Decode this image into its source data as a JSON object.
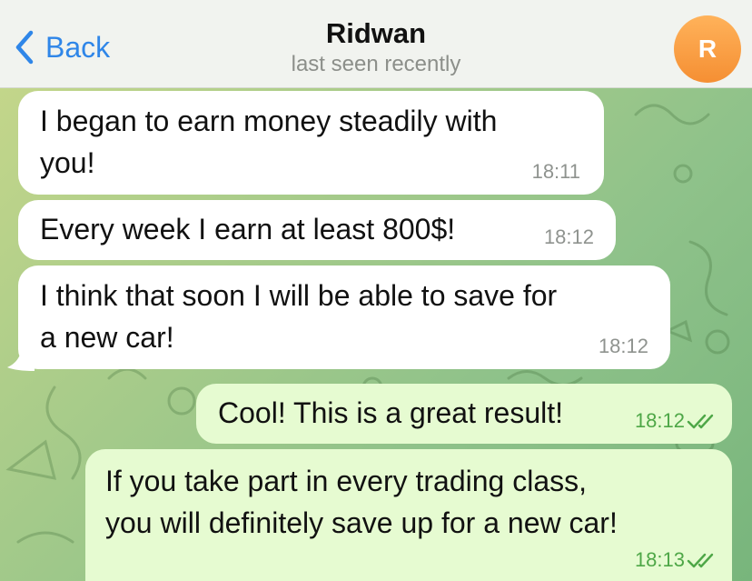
{
  "header": {
    "back_label": "Back",
    "contact_name": "Ridwan",
    "status": "last seen recently",
    "avatar_initial": "R"
  },
  "messages": [
    {
      "direction": "incoming",
      "line1": "I began to earn money steadily with",
      "line2": "you!",
      "time": "18:11"
    },
    {
      "direction": "incoming",
      "line1": "Every week I earn at least 800$!",
      "time": "18:12"
    },
    {
      "direction": "incoming",
      "line1": "I think that soon I will be able to save for",
      "line2": "a new car!",
      "time": "18:12"
    },
    {
      "direction": "outgoing",
      "line1": "Cool! This is a great result!",
      "time": "18:12",
      "read": true
    },
    {
      "direction": "outgoing",
      "line1": "If you take part in every trading class,",
      "line2": "you will definitely save up for a new car!",
      "time": "18:13",
      "read": true
    }
  ],
  "colors": {
    "accent": "#2f86e8",
    "incoming_bubble": "#ffffff",
    "outgoing_bubble": "#e6fbd1",
    "outgoing_time": "#4ea747",
    "avatar": "#f7993c"
  },
  "icons": [
    "chevron-left-icon",
    "double-check-icon"
  ]
}
